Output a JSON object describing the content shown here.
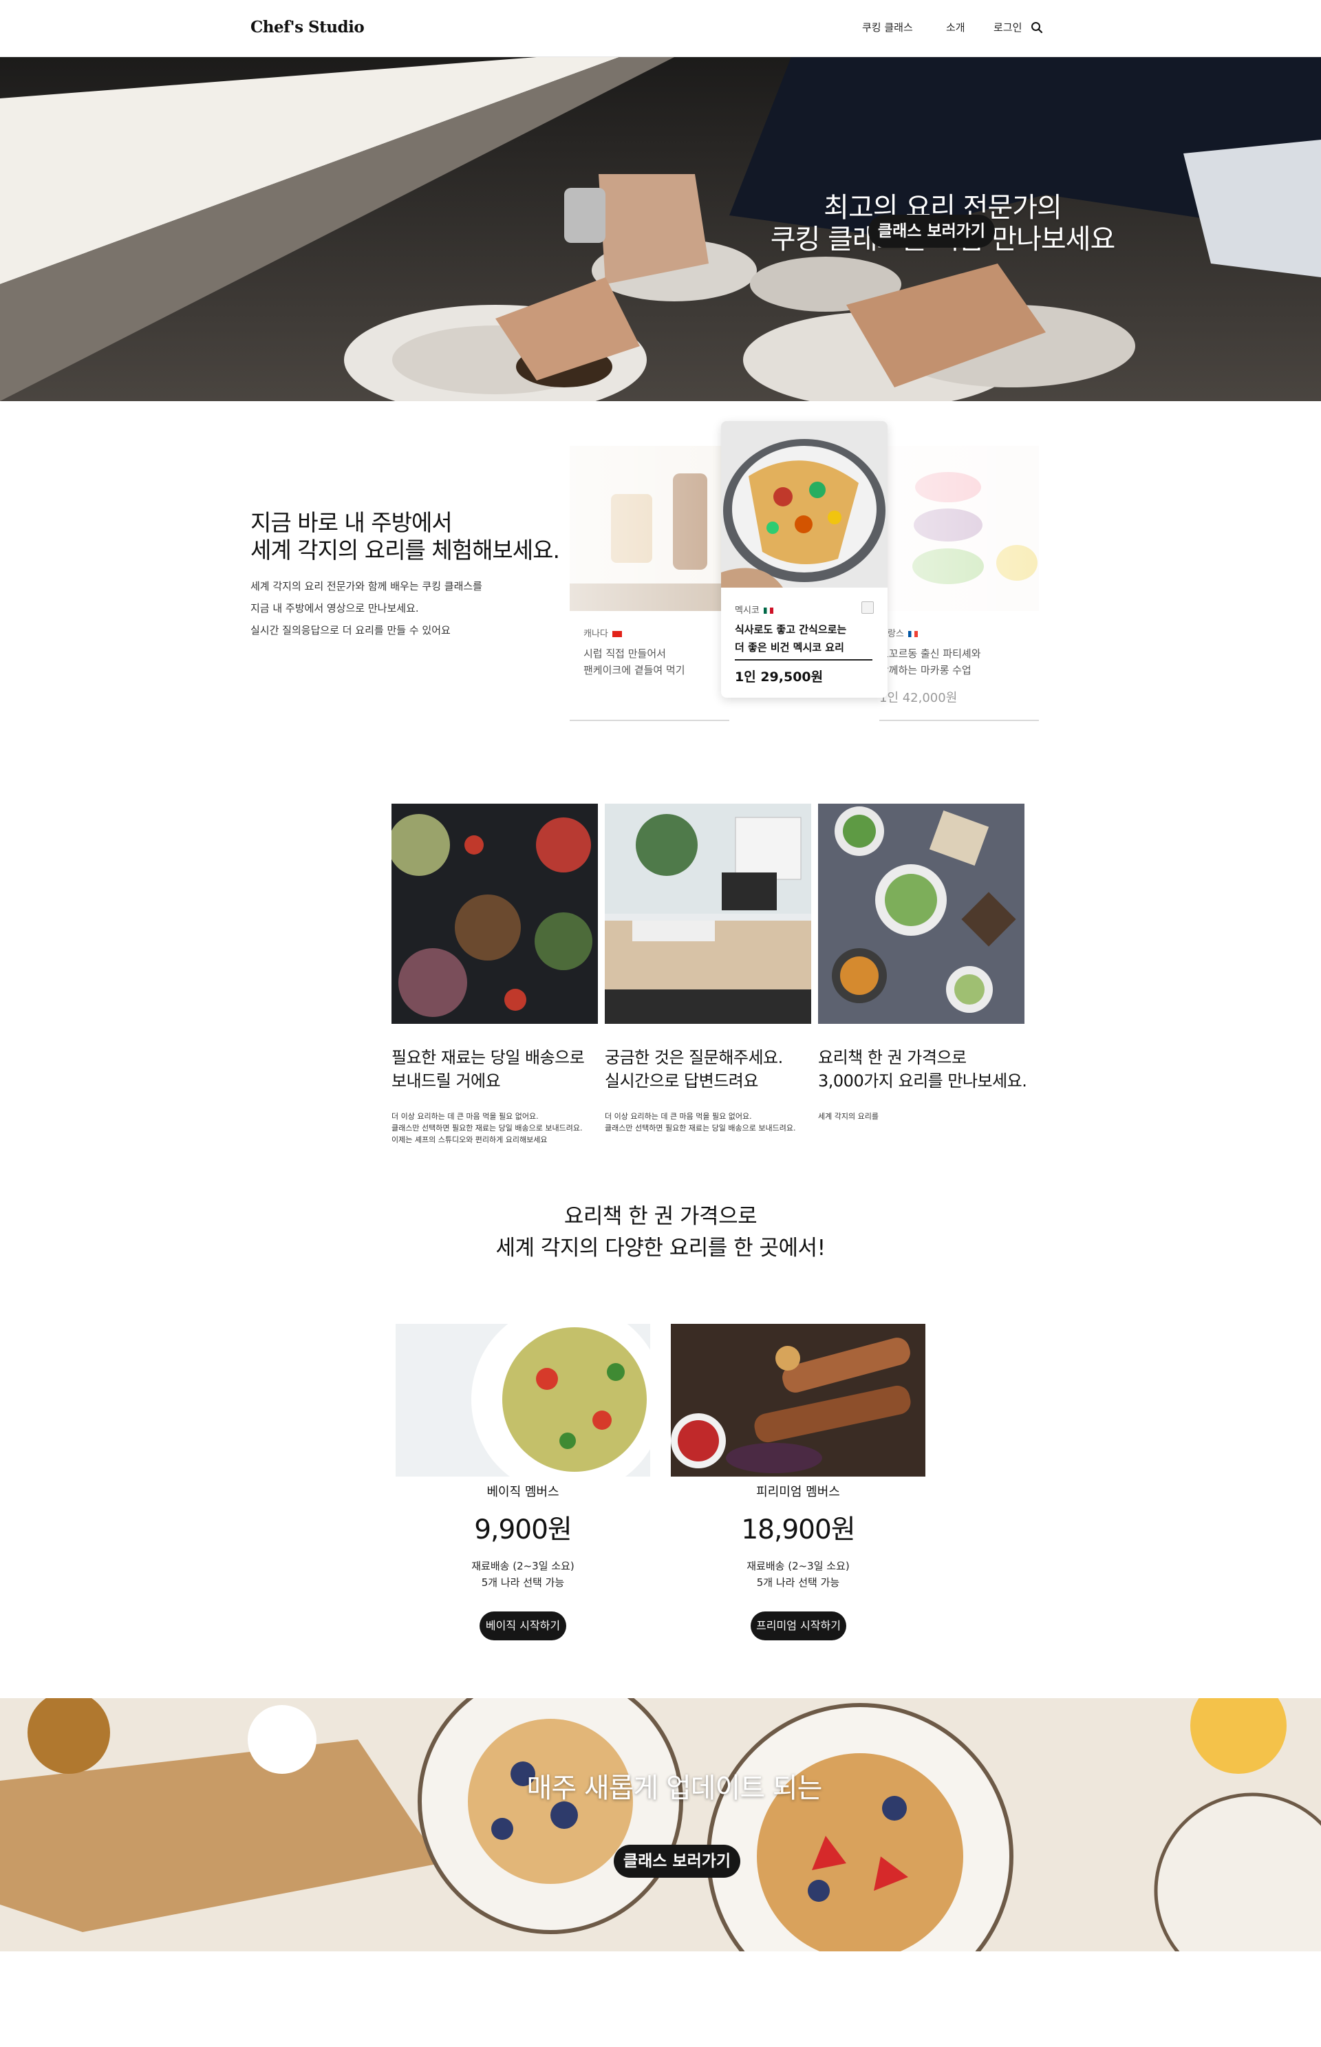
{
  "header": {
    "logo": "Chef's Studio",
    "nav": {
      "cooking_class": "쿠킹 클래스",
      "about": "소개",
      "login": "로그인"
    }
  },
  "hero": {
    "title_line1": "최고의 요리 전문가의",
    "title_line2": "쿠킹 클래스를 지금 만나보세요",
    "cta": "클래스 보러가기"
  },
  "experience": {
    "title_line1": "지금 바로 내 주방에서",
    "title_line2": "세계 각지의 요리를 체험해보세요.",
    "desc": [
      "세계 각지의 요리 전문가와 함께 배우는 쿠킹 클래스를",
      "지금 내 주방에서 영상으로 만나보세요.",
      "실시간 질의응답으로 더 요리를 만들 수 있어요"
    ],
    "cards": {
      "left": {
        "country": "캐나다",
        "title_line1": "시럽 직접 만들어서",
        "title_line2": "팬케이크에 곁들여 먹기"
      },
      "main": {
        "country": "멕시코",
        "title_line1": "식사로도 좋고 간식으로는",
        "title_line2": "더 좋은 비건 멕시코 요리",
        "price": "1인 29,500원"
      },
      "right": {
        "country": "프랑스",
        "title_line1": "르꼬르동 출신 파티셰와",
        "title_line2": "함께하는 마카롱 수업",
        "price": "1인 42,000원"
      }
    }
  },
  "features": [
    {
      "title_line1": "필요한 재료는 당일 배송으로",
      "title_line2": "보내드릴 거에요",
      "desc": [
        "더 이상 요리하는 데 큰 마음 먹을 필요 없어요.",
        "클래스만 선택하면 필요한 재료는 당일 배송으로 보내드려요.",
        "이제는 셰프의 스튜디오와 편리하게 요리해보세요"
      ]
    },
    {
      "title_line1": "궁금한 것은 질문해주세요.",
      "title_line2": "실시간으로 답변드려요",
      "desc": [
        "더 이상 요리하는 데 큰 마음 먹을 필요 없어요.",
        "클래스만 선택하면 필요한 재료는 당일 배송으로 보내드려요."
      ]
    },
    {
      "title_line1": "요리책 한 권 가격으로",
      "title_line2": "3,000가지 요리를 만나보세요.",
      "desc": [
        "세계 각지의 요리를"
      ]
    }
  ],
  "membership": {
    "title_line1": "요리책 한 권 가격으로",
    "title_line2": "세계 각지의 다양한 요리를 한 곳에서!",
    "plans": [
      {
        "name": "베이직 멤버스",
        "price": "9,900원",
        "note1": "재료배송 (2~3일 소요)",
        "note2": "5개 나라 선택 가능",
        "cta": "베이직 시작하기"
      },
      {
        "name": "피리미엄 멤버스",
        "price": "18,900원",
        "note1": "재료배송 (2~3일 소요)",
        "note2": "5개 나라 선택 가능",
        "cta": "프리미엄 시작하기"
      }
    ]
  },
  "banner": {
    "title": "매주 새롭게 업데이트 되는",
    "cta": "클래스 보러가기"
  },
  "colors": {
    "button_bg": "#161616",
    "text": "#111111",
    "divider": "#e6e6e6"
  }
}
